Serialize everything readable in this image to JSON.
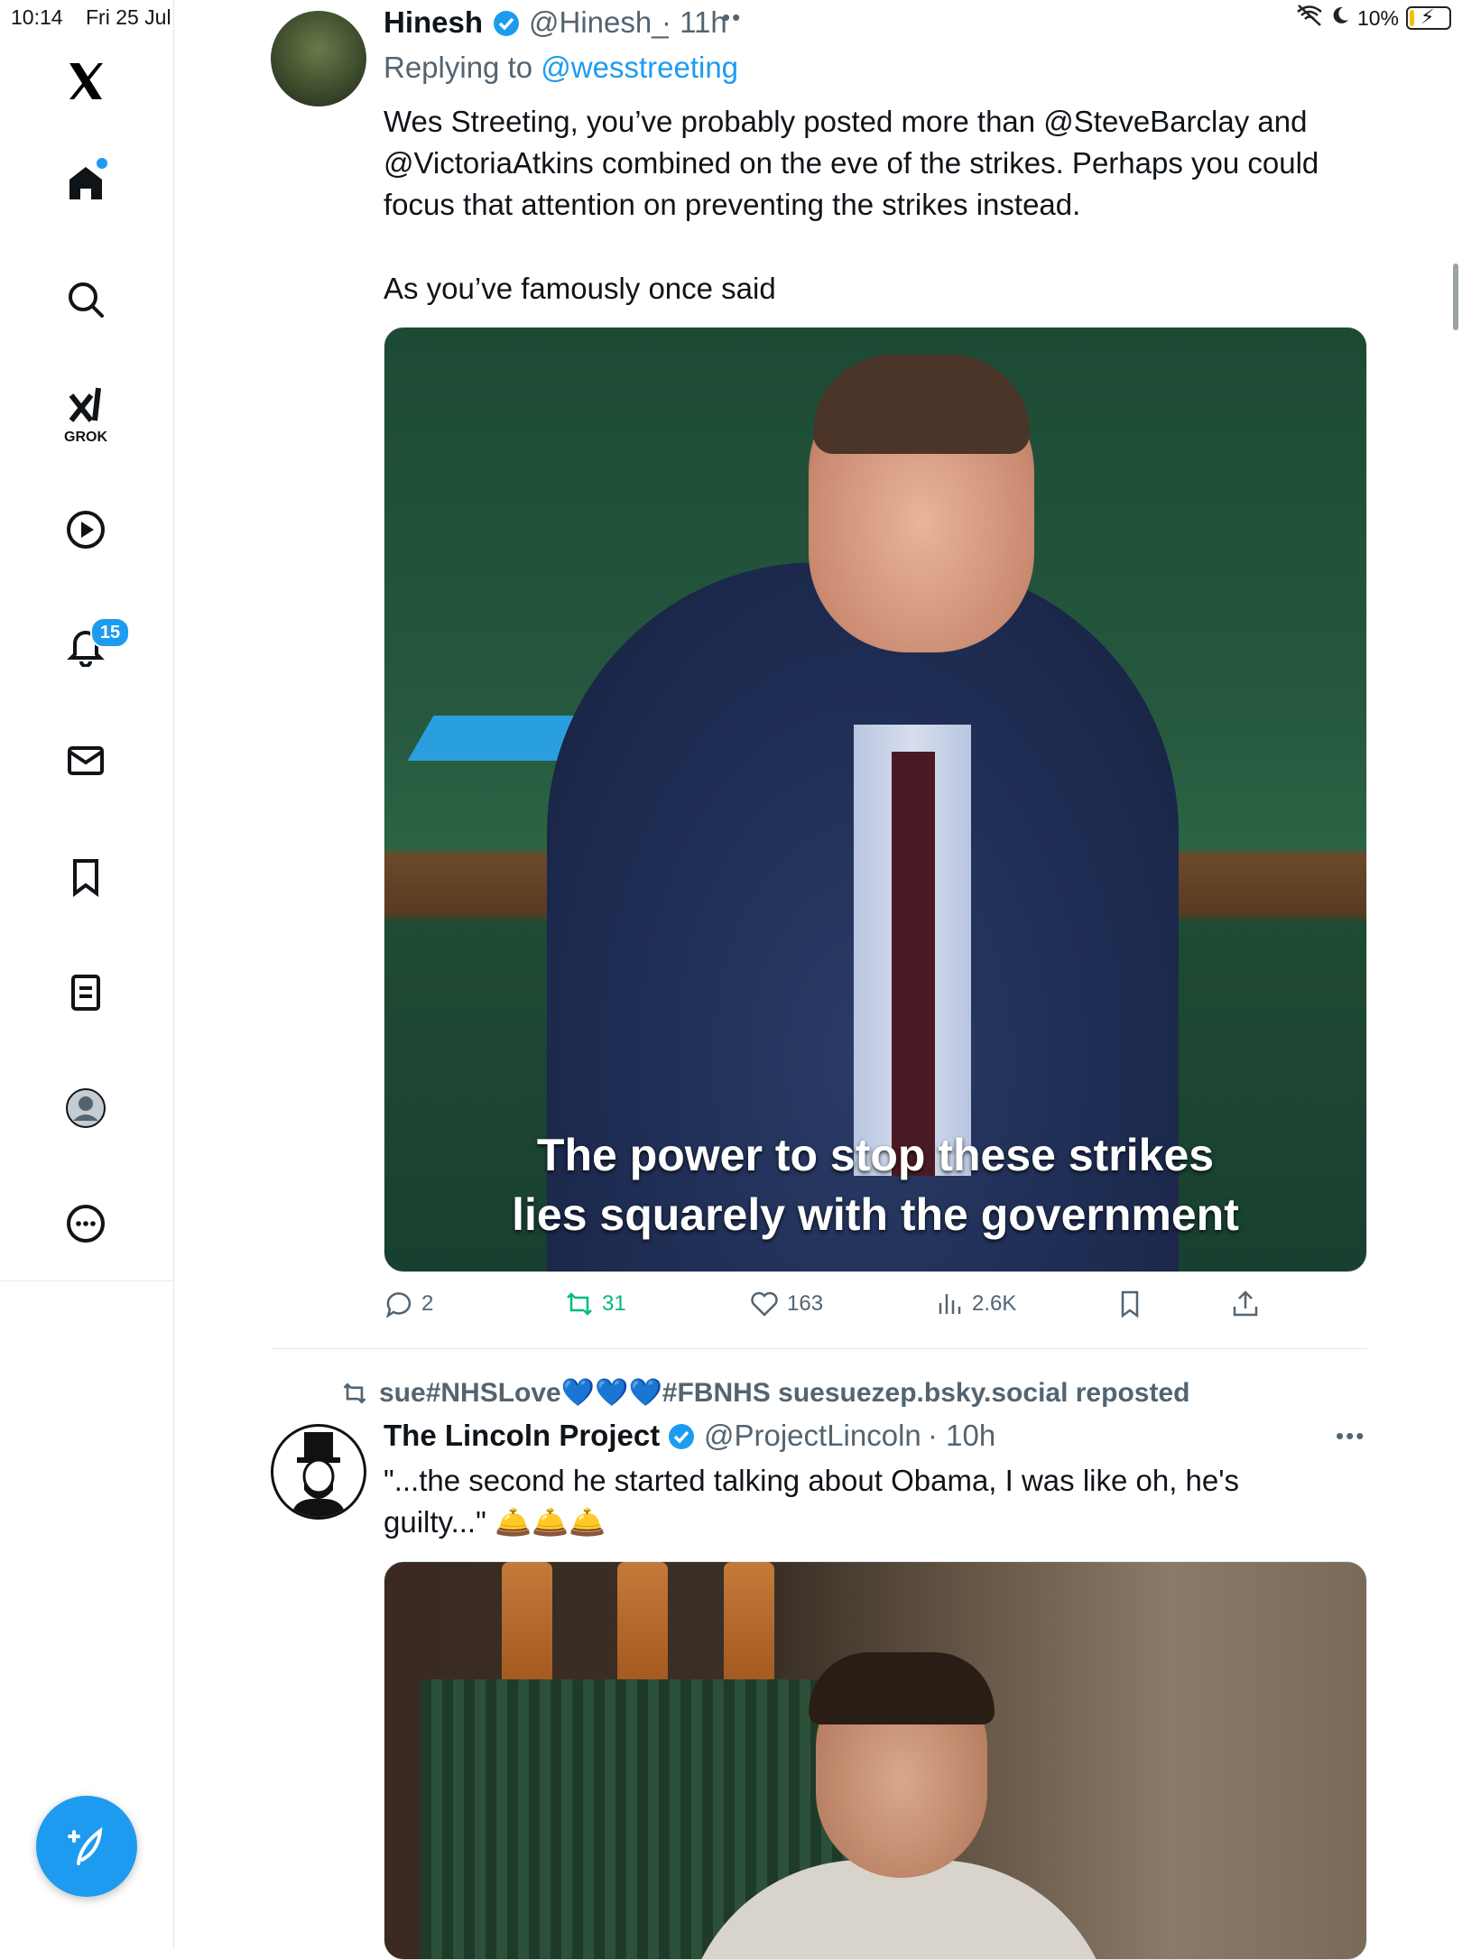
{
  "status_bar": {
    "time": "10:14",
    "date": "Fri 25 Jul",
    "battery": "10%"
  },
  "sidebar": {
    "notifications_badge": "15",
    "grok_label": "GROK"
  },
  "tweet1": {
    "name": "Hinesh",
    "handle": "@Hinesh_",
    "time": "· 11h",
    "replying_prefix": "Replying to ",
    "replying_to": "@wesstreeting",
    "text_lines": [
      "Wes Streeting, you’ve probably posted more than @SteveBarclay and",
      "@VictoriaAtkins combined on the eve of the strikes. Perhaps you could",
      "focus that attention on preventing the strikes instead."
    ],
    "text_line2": "As you’ve famously once said",
    "media_caption": [
      "The power to stop these strikes",
      "lies squarely with the government"
    ],
    "stats": {
      "replies": "2",
      "reposts": "31",
      "likes": "163",
      "views": "2.6K"
    }
  },
  "tweet2": {
    "reposted_by": "sue#NHSLove💙💙💙#FBNHS suesuezep.bsky.social reposted",
    "name": "The Lincoln Project",
    "handle": "@ProjectLincoln",
    "time": "· 10h",
    "text_lines": [
      "\"...the second he started talking about Obama, I was like oh, he's",
      "guilty...\" 🛎️🛎️🛎️"
    ]
  },
  "colors": {
    "accent": "#1d9bf0",
    "repost": "#00ba7c",
    "muted": "#536471"
  }
}
